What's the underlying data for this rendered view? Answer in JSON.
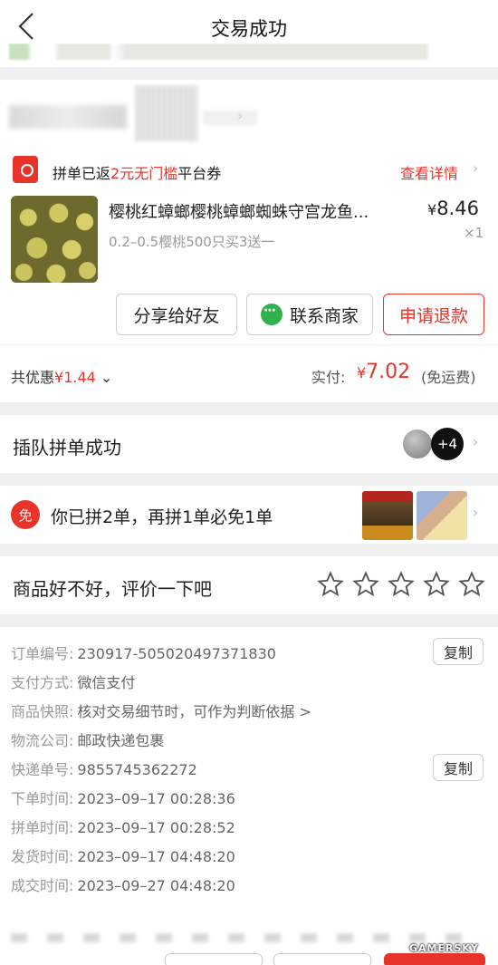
{
  "header": {
    "title": "交易成功"
  },
  "coupon": {
    "prefix": "拼单已返",
    "highlight": "2元无门槛",
    "suffix": "平台券",
    "link": "查看详情"
  },
  "product": {
    "name": "樱桃红蟑螂樱桃蟑螂蜘蛛守宫龙鱼...",
    "spec": "0.2–0.5樱桃500只买3送一",
    "currency": "¥",
    "price": "8.46",
    "quantity": "×1"
  },
  "actions": {
    "share": "分享给好友",
    "contact": "联系商家",
    "refund": "申请退款"
  },
  "summary": {
    "discount_label": "共优惠",
    "discount_value": "¥1.44",
    "paid_label": "实付:",
    "paid_currency": "¥",
    "paid_value": "7.02",
    "paid_note": "(免运费)"
  },
  "group": {
    "title": "插队拼单成功",
    "more_count": "+4"
  },
  "free_order": {
    "badge": "免",
    "text": "你已拼2单，再拼1单必免1单"
  },
  "rating": {
    "title": "商品好不好，评价一下吧",
    "stars": 5
  },
  "details": {
    "order_no_label": "订单编号:",
    "order_no": "230917-505020497371830",
    "payment_label": "支付方式:",
    "payment": "微信支付",
    "snapshot_label": "商品快照:",
    "snapshot": "核对交易细节时，可作为判断依据 >",
    "logistics_label": "物流公司:",
    "logistics": "邮政快递包裹",
    "tracking_label": "快递单号:",
    "tracking": "9855745362272",
    "order_time_label": "下单时间:",
    "order_time": "2023–09–17 00:28:36",
    "group_time_label": "拼单时间:",
    "group_time": "2023–09–17 00:28:52",
    "ship_time_label": "发货时间:",
    "ship_time": "2023–09–17 04:48:20",
    "deal_time_label": "成交时间:",
    "deal_time": "2023–09–27 04:48:20",
    "copy_label": "复制"
  },
  "watermark": "GAMERSKY",
  "colors": {
    "accent": "#e8332a",
    "wechat": "#2fb24c"
  }
}
